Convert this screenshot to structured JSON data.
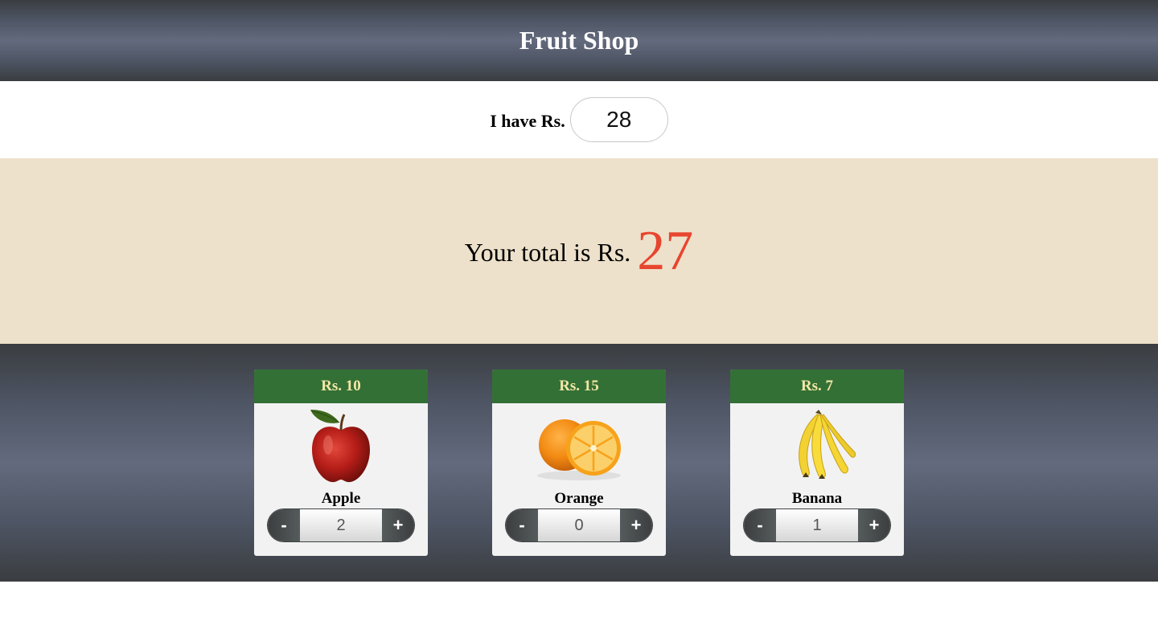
{
  "header": {
    "title": "Fruit Shop"
  },
  "budget": {
    "label": "I have Rs.",
    "value": "28"
  },
  "total": {
    "label": "Your total is Rs.",
    "value": "27"
  },
  "colors": {
    "accent_total": "#e8452f",
    "price_bar": "#337035",
    "price_text": "#f3e7a6",
    "total_band": "#ede1cb"
  },
  "products": [
    {
      "price": "Rs. 10",
      "name": "Apple",
      "quantity": "2",
      "minus_label": "-",
      "plus_label": "+",
      "icon": "apple-icon"
    },
    {
      "price": "Rs. 15",
      "name": "Orange",
      "quantity": "0",
      "minus_label": "-",
      "plus_label": "+",
      "icon": "orange-icon"
    },
    {
      "price": "Rs. 7",
      "name": "Banana",
      "quantity": "1",
      "minus_label": "-",
      "plus_label": "+",
      "icon": "banana-icon"
    }
  ]
}
